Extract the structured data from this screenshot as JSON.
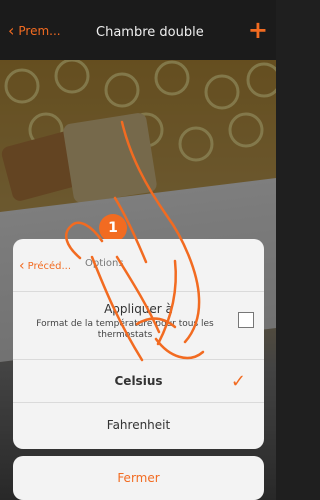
{
  "topbar": {
    "back_label": "Prem...",
    "title": "Chambre double"
  },
  "modal": {
    "back_label": "Précéd...",
    "title": "Options",
    "apply": {
      "heading": "Appliquer à",
      "description": "Format de la température pour tous les thermostats"
    },
    "options": [
      {
        "label": "Celsius",
        "selected": true
      },
      {
        "label": "Fahrenheit",
        "selected": false
      }
    ]
  },
  "close_label": "Fermer",
  "step_marker": "1",
  "colors": {
    "accent": "#f26b21"
  }
}
